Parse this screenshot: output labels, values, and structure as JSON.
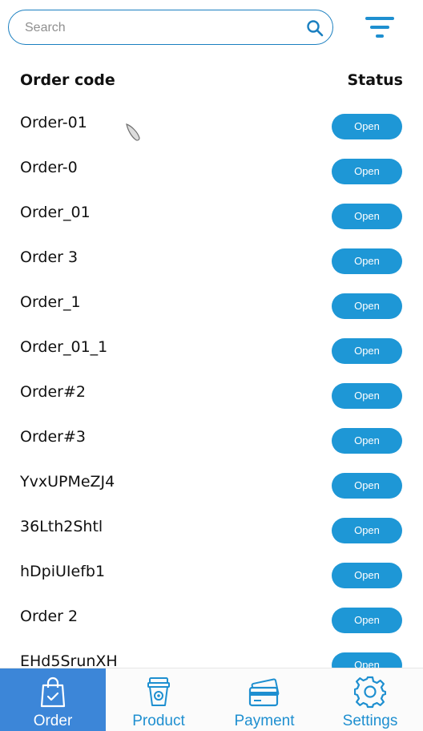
{
  "search": {
    "placeholder": "Search",
    "value": ""
  },
  "icons": {
    "search": "search-icon",
    "filter": "filter-icon"
  },
  "columns": {
    "code": "Order code",
    "status": "Status"
  },
  "orders": [
    {
      "code": "Order-01",
      "status": "Open"
    },
    {
      "code": "Order-0",
      "status": "Open"
    },
    {
      "code": "Order_01",
      "status": "Open"
    },
    {
      "code": "Order 3",
      "status": "Open"
    },
    {
      "code": "Order_1",
      "status": "Open"
    },
    {
      "code": "Order_01_1",
      "status": "Open"
    },
    {
      "code": "Order#2",
      "status": "Open"
    },
    {
      "code": "Order#3",
      "status": "Open"
    },
    {
      "code": "YvxUPMeZJ4",
      "status": "Open"
    },
    {
      "code": "36Lth2Shtl",
      "status": "Open"
    },
    {
      "code": "hDpiUIefb1",
      "status": "Open"
    },
    {
      "code": "Order 2",
      "status": "Open"
    },
    {
      "code": "EHd5SrunXH",
      "status": "Open"
    }
  ],
  "nav": [
    {
      "label": "Order",
      "icon": "shopping-bag-icon",
      "active": true
    },
    {
      "label": "Product",
      "icon": "coffee-cup-icon",
      "active": false
    },
    {
      "label": "Payment",
      "icon": "credit-card-icon",
      "active": false
    },
    {
      "label": "Settings",
      "icon": "gear-icon",
      "active": false
    }
  ],
  "colors": {
    "accent": "#1e97d6",
    "active_tab": "#3c86d8",
    "nav_text": "#1e8fd0"
  }
}
